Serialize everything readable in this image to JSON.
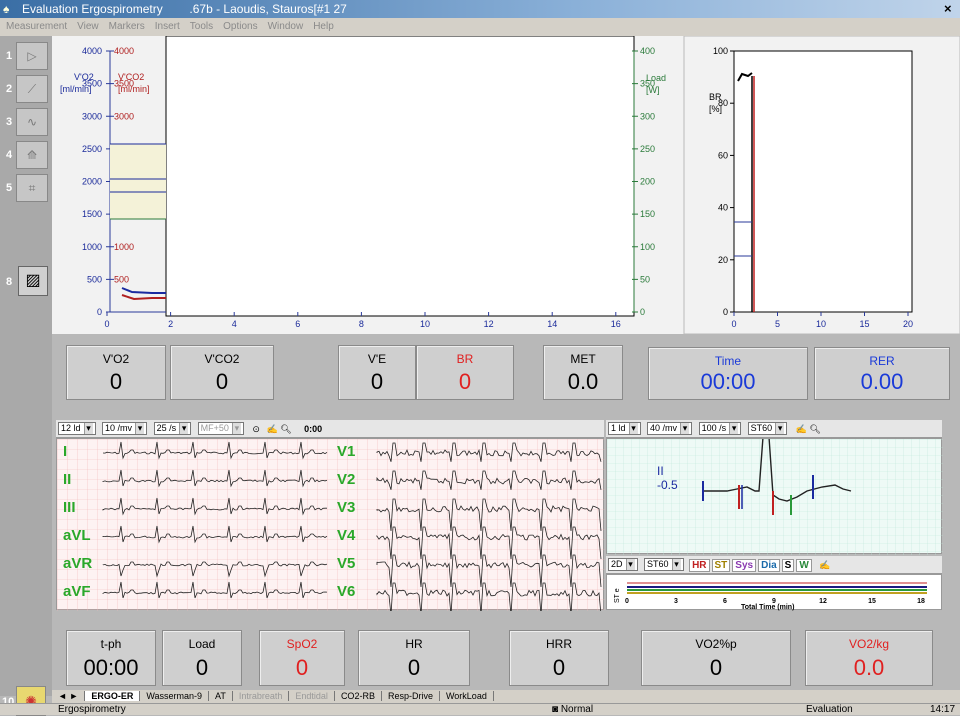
{
  "window": {
    "title": "Evaluation Ergospirometry",
    "subtitle": ".67b - Laoudis, Stauros[#1 27",
    "close_label": "×"
  },
  "menu": [
    "Measurement",
    "View",
    "Markers",
    "Insert",
    "Tools",
    "Options",
    "Window",
    "Help"
  ],
  "tools": {
    "numbers": [
      "1",
      "2",
      "3",
      "4",
      "5",
      "8",
      "10"
    ]
  },
  "main_chart": {
    "left_axis_title_1": "V'O2",
    "left_axis_title_2": "[ml/min]",
    "co2_axis_title_1": "V'CO2",
    "co2_axis_title_2": "[ml/min]",
    "right_axis_title_1": "Load",
    "right_axis_title_2": "[W]",
    "left_ticks": [
      "4000",
      "3500",
      "3000",
      "2500",
      "2000",
      "1500",
      "1000",
      "500",
      "0"
    ],
    "co2_ticks": [
      "4000",
      "3500",
      "3000",
      "2500",
      "2000",
      "1500",
      "1000",
      "500"
    ],
    "right_ticks": [
      "400",
      "350",
      "300",
      "250",
      "200",
      "150",
      "100",
      "50",
      "0"
    ],
    "x_ticks": [
      "0",
      "2",
      "4",
      "6",
      "8",
      "10",
      "12",
      "14",
      "16"
    ]
  },
  "br_chart": {
    "axis_title_1": "BR",
    "axis_title_2": "[%]",
    "y_ticks": [
      "100",
      "80",
      "60",
      "40",
      "20",
      "0"
    ],
    "x_ticks": [
      "0",
      "5",
      "10",
      "15",
      "20"
    ]
  },
  "values_top": [
    {
      "label": "V'O2",
      "value": "0",
      "color": "#000000"
    },
    {
      "label": "V'CO2",
      "value": "0",
      "color": "#000000"
    },
    {
      "label": "V'E",
      "value": "0",
      "color": "#000000"
    },
    {
      "label": "BR",
      "value": "0",
      "color": "#e02020"
    },
    {
      "label": "MET",
      "value": "0.0",
      "color": "#000000"
    },
    {
      "label": "Time",
      "value": "00:00",
      "color": "#1a3ad8"
    },
    {
      "label": "RER",
      "value": "0.00",
      "color": "#1a3ad8"
    }
  ],
  "values_bottom": [
    {
      "label": "t-ph",
      "value": "00:00",
      "color": "#000000"
    },
    {
      "label": "Load",
      "value": "0",
      "color": "#000000"
    },
    {
      "label": "SpO2",
      "value": "0",
      "color": "#e02020"
    },
    {
      "label": "HR",
      "value": "0",
      "color": "#000000"
    },
    {
      "label": "HRR",
      "value": "0",
      "color": "#000000"
    },
    {
      "label": "VO2%p",
      "value": "0",
      "color": "#000000"
    },
    {
      "label": "VO2/kg",
      "value": "0.0",
      "color": "#e02020"
    }
  ],
  "ecg_toolbar": {
    "leads": "12 ld",
    "gain": "10 /mv",
    "speed": "25 /s",
    "filter": "MF+50",
    "time": "0:00"
  },
  "st_toolbar": {
    "leads": "1 ld",
    "gain": "40 /mv",
    "speed": "100 /s",
    "mode": "ST60"
  },
  "ecg_leads_left": [
    "I",
    "II",
    "III",
    "aVL",
    "aVR",
    "aVF"
  ],
  "ecg_leads_right": [
    "V1",
    "V2",
    "V3",
    "V4",
    "V5",
    "V6"
  ],
  "st_panel": {
    "lead": "II",
    "value": "-0.5"
  },
  "trend_toolbar": {
    "mode": "2D",
    "st": "ST60",
    "buttons": [
      "HR",
      "ST",
      "Sys",
      "Dia",
      "S",
      "W"
    ],
    "x_label": "Total Time (min)",
    "y_label": "ST e",
    "x_ticks": [
      "0",
      "3",
      "6",
      "9",
      "12",
      "15",
      "18"
    ]
  },
  "tabs": [
    "ERGO-ER",
    "Wasserman-9",
    "AT",
    "Intrabreath",
    "Endtidal",
    "CO2-RB",
    "Resp-Drive",
    "WorkLoad"
  ],
  "status": {
    "left": "Ergospirometry",
    "mode": "Normal",
    "right": "Evaluation",
    "clock": "14:17"
  }
}
